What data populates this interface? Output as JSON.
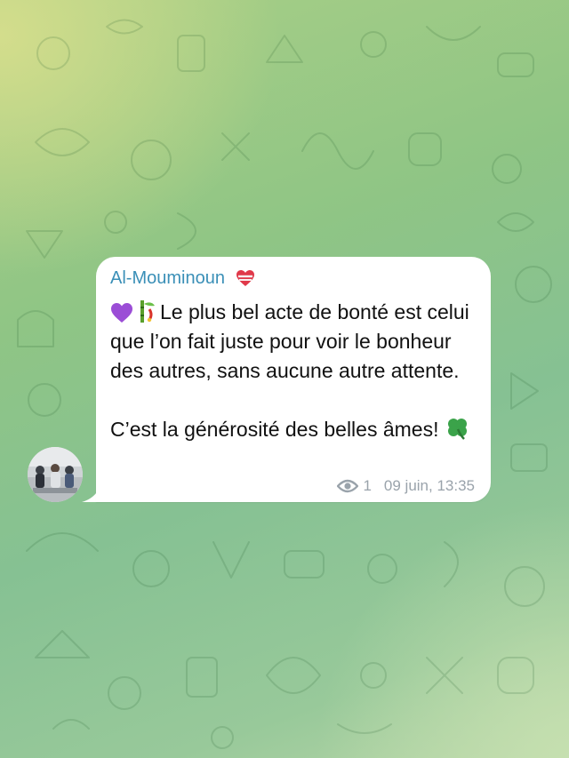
{
  "message": {
    "sender": "Al-Mouminoun",
    "sender_badge_icon": "broken-heart-icon",
    "lead_icons": [
      "purple-heart-icon",
      "bamboo-icon"
    ],
    "paragraph1": "Le plus bel acte de bonté est celui que l’on fait juste pour voir le bonheur des autres, sans aucune autre attente.",
    "paragraph2": "C’est la générosité des belles âmes!",
    "trailing_icon": "four-leaf-clover-icon",
    "views": "1",
    "timestamp": "09 juin, 13:35"
  },
  "colors": {
    "sender_name": "#3a8fb7",
    "bubble": "#ffffff",
    "meta_text": "#9aa3ab",
    "wallpaper_green": "#8fc585"
  }
}
